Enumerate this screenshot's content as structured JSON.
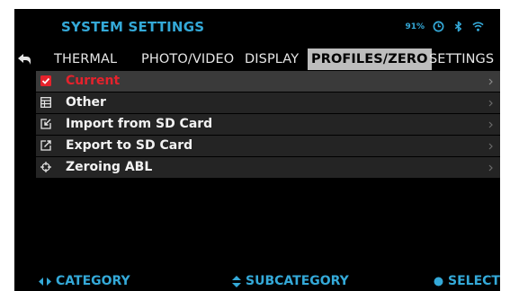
{
  "header": {
    "title": "SYSTEM SETTINGS",
    "battery": "91%",
    "status_icons": [
      "battery-timer-icon",
      "bluetooth-icon",
      "wifi-icon"
    ]
  },
  "tabs": [
    {
      "label": "THERMAL",
      "active": false
    },
    {
      "label": "PHOTO/VIDEO",
      "active": false
    },
    {
      "label": "DISPLAY",
      "active": false
    },
    {
      "label": "PROFILES/ZERO",
      "active": true
    },
    {
      "label": "SETTINGS",
      "active": false
    }
  ],
  "menu": {
    "items": [
      {
        "label": "Current",
        "icon": "checkbox-checked-icon",
        "selected": true
      },
      {
        "label": "Other",
        "icon": "profile-list-icon",
        "selected": false
      },
      {
        "label": "Import from SD Card",
        "icon": "import-icon",
        "selected": false
      },
      {
        "label": "Export to SD Card",
        "icon": "export-icon",
        "selected": false
      },
      {
        "label": "Zeroing ABL",
        "icon": "zeroing-crosshair-icon",
        "selected": false
      }
    ]
  },
  "footer": {
    "category": "CATEGORY",
    "subcategory": "SUBCATEGORY",
    "select": "SELECT"
  },
  "colors": {
    "accent": "#34a9d8",
    "selected_text": "#e5222c",
    "active_tab_bg": "#bdbdbd",
    "background": "#000000"
  }
}
